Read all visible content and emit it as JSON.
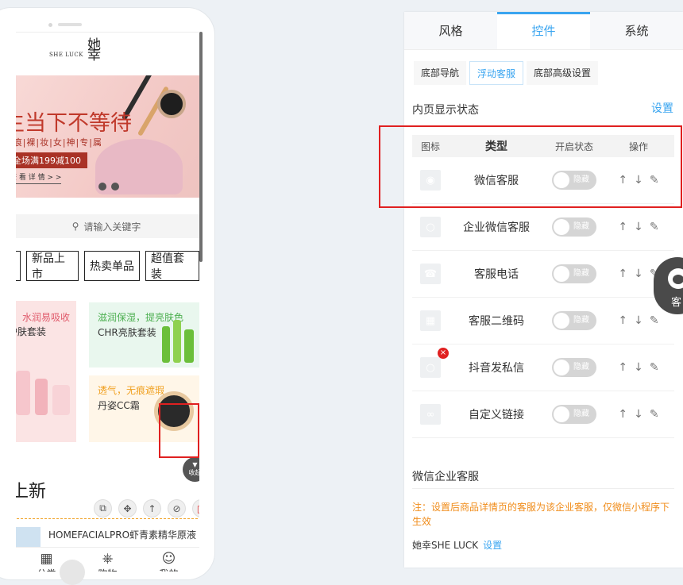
{
  "preview": {
    "logo": {
      "text": "SHE LUCK",
      "mark": "她幸"
    },
    "banner": {
      "title": "生当下不等待",
      "subtitle": "|痕|裸|妆|女|神|专|属",
      "promo": "全场满199减100",
      "detail": "查 看 详 情 > >"
    },
    "search_placeholder": "请输入关键字",
    "categories": [
      "",
      "新品上市",
      "热卖单品",
      "超值套装"
    ],
    "products": [
      {
        "title": "水润易吸收",
        "subtitle": "护肤套装"
      },
      {
        "title": "滋润保湿，提亮肤色",
        "subtitle": "CHR亮肤套装"
      },
      {
        "title": "透气，无痕遮瑕",
        "subtitle": "丹姿CC霜"
      }
    ],
    "collapse_label": "收起",
    "section_title": "上新",
    "list_item": "HOMEFACIALPRO虾青素精华原液 ...",
    "tabbar": [
      {
        "label": "分类",
        "icon": "grid-icon"
      },
      {
        "label": "购物",
        "icon": "cart-icon"
      },
      {
        "label": "我的",
        "icon": "user-icon"
      }
    ]
  },
  "panel": {
    "tabs": [
      "风格",
      "控件",
      "系统"
    ],
    "active_tab": "控件",
    "subtabs": [
      "底部导航",
      "浮动客服",
      "底部高级设置"
    ],
    "active_subtab": "浮动客服",
    "section_label": "内页显示状态",
    "settings_link": "设置",
    "table_headers": {
      "icon": "图标",
      "type": "类型",
      "state": "开启状态",
      "ops": "操作"
    },
    "rows": [
      {
        "type": "微信客服",
        "toggle": "隐藏",
        "icon": "wechat-icon"
      },
      {
        "type": "企业微信客服",
        "toggle": "隐藏",
        "icon": "chat-bubble-icon"
      },
      {
        "type": "客服电话",
        "toggle": "隐藏",
        "icon": "phone-icon"
      },
      {
        "type": "客服二维码",
        "toggle": "隐藏",
        "icon": "qrcode-icon"
      },
      {
        "type": "抖音发私信",
        "toggle": "隐藏",
        "icon": "message-icon"
      },
      {
        "type": "自定义链接",
        "toggle": "隐藏",
        "icon": "link-icon"
      }
    ],
    "enterprise_title": "微信企业客服",
    "note": "注：设置后商品详情页的客服为该企业客服，仅微信小程序下生效",
    "brand": "她幸SHE LUCK",
    "brand_link": "设置"
  },
  "floating_service": {
    "label": "客"
  },
  "colors": {
    "accent": "#3aa5f0",
    "highlight": "#e02020",
    "warning": "#f08c1a"
  }
}
